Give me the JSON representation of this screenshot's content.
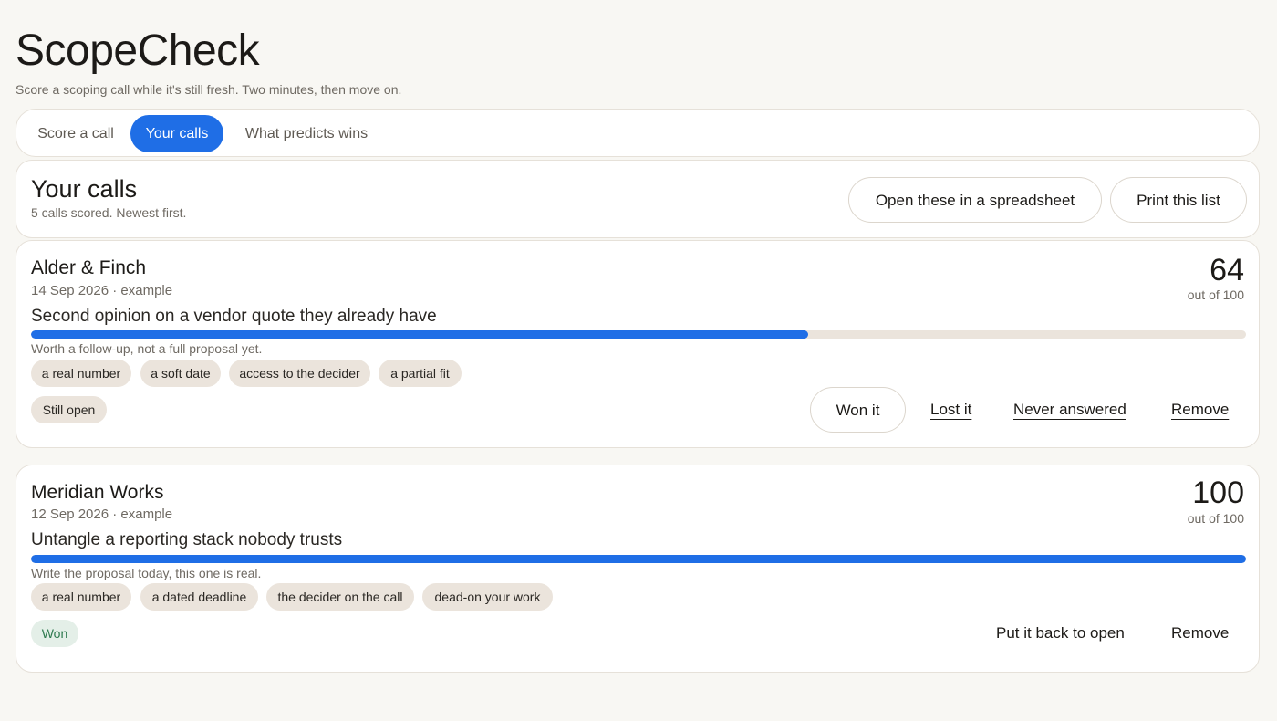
{
  "app": {
    "title": "ScopeCheck",
    "subtitle": "Score a scoping call while it's still fresh. Two minutes, then move on."
  },
  "tabs": [
    {
      "label": "Score a call",
      "active": false
    },
    {
      "label": "Your calls",
      "active": true
    },
    {
      "label": "What predicts wins",
      "active": false
    }
  ],
  "colors": {
    "accent": "#1f6ee6",
    "tag_background": "#ebe4dc",
    "won_text": "#2e7a4f",
    "page_background": "#f8f7f3"
  },
  "calls_header": {
    "title": "Your calls",
    "meta": "5 calls scored. Newest first.",
    "spreadsheet_label": "Open these in a spreadsheet",
    "print_label": "Print this list"
  },
  "calls": [
    {
      "client": "Alder & Finch",
      "date": "14 Sep 2026 · example",
      "score": "64",
      "score_fraction": 0.64,
      "out_of": "out of 100",
      "engagement": "Second opinion on a vendor quote they already have",
      "verdict": "Worth a follow-up, not a full proposal yet.",
      "tags": [
        "a real number",
        "a soft date",
        "access to the decider",
        "a partial fit"
      ],
      "status": "Still open",
      "actions": {
        "won": "Won it",
        "lost": "Lost it",
        "never_answered": "Never answered",
        "remove": "Remove"
      }
    },
    {
      "client": "Meridian Works",
      "date": "12 Sep 2026 · example",
      "score": "100",
      "score_fraction": 1.0,
      "out_of": "out of 100",
      "engagement": "Untangle a reporting stack nobody trusts",
      "verdict": "Write the proposal today, this one is real.",
      "tags": [
        "a real number",
        "a dated deadline",
        "the decider on the call",
        "dead-on your work"
      ],
      "status": "Won",
      "actions": {
        "reopen": "Put it back to open",
        "remove": "Remove"
      }
    }
  ]
}
